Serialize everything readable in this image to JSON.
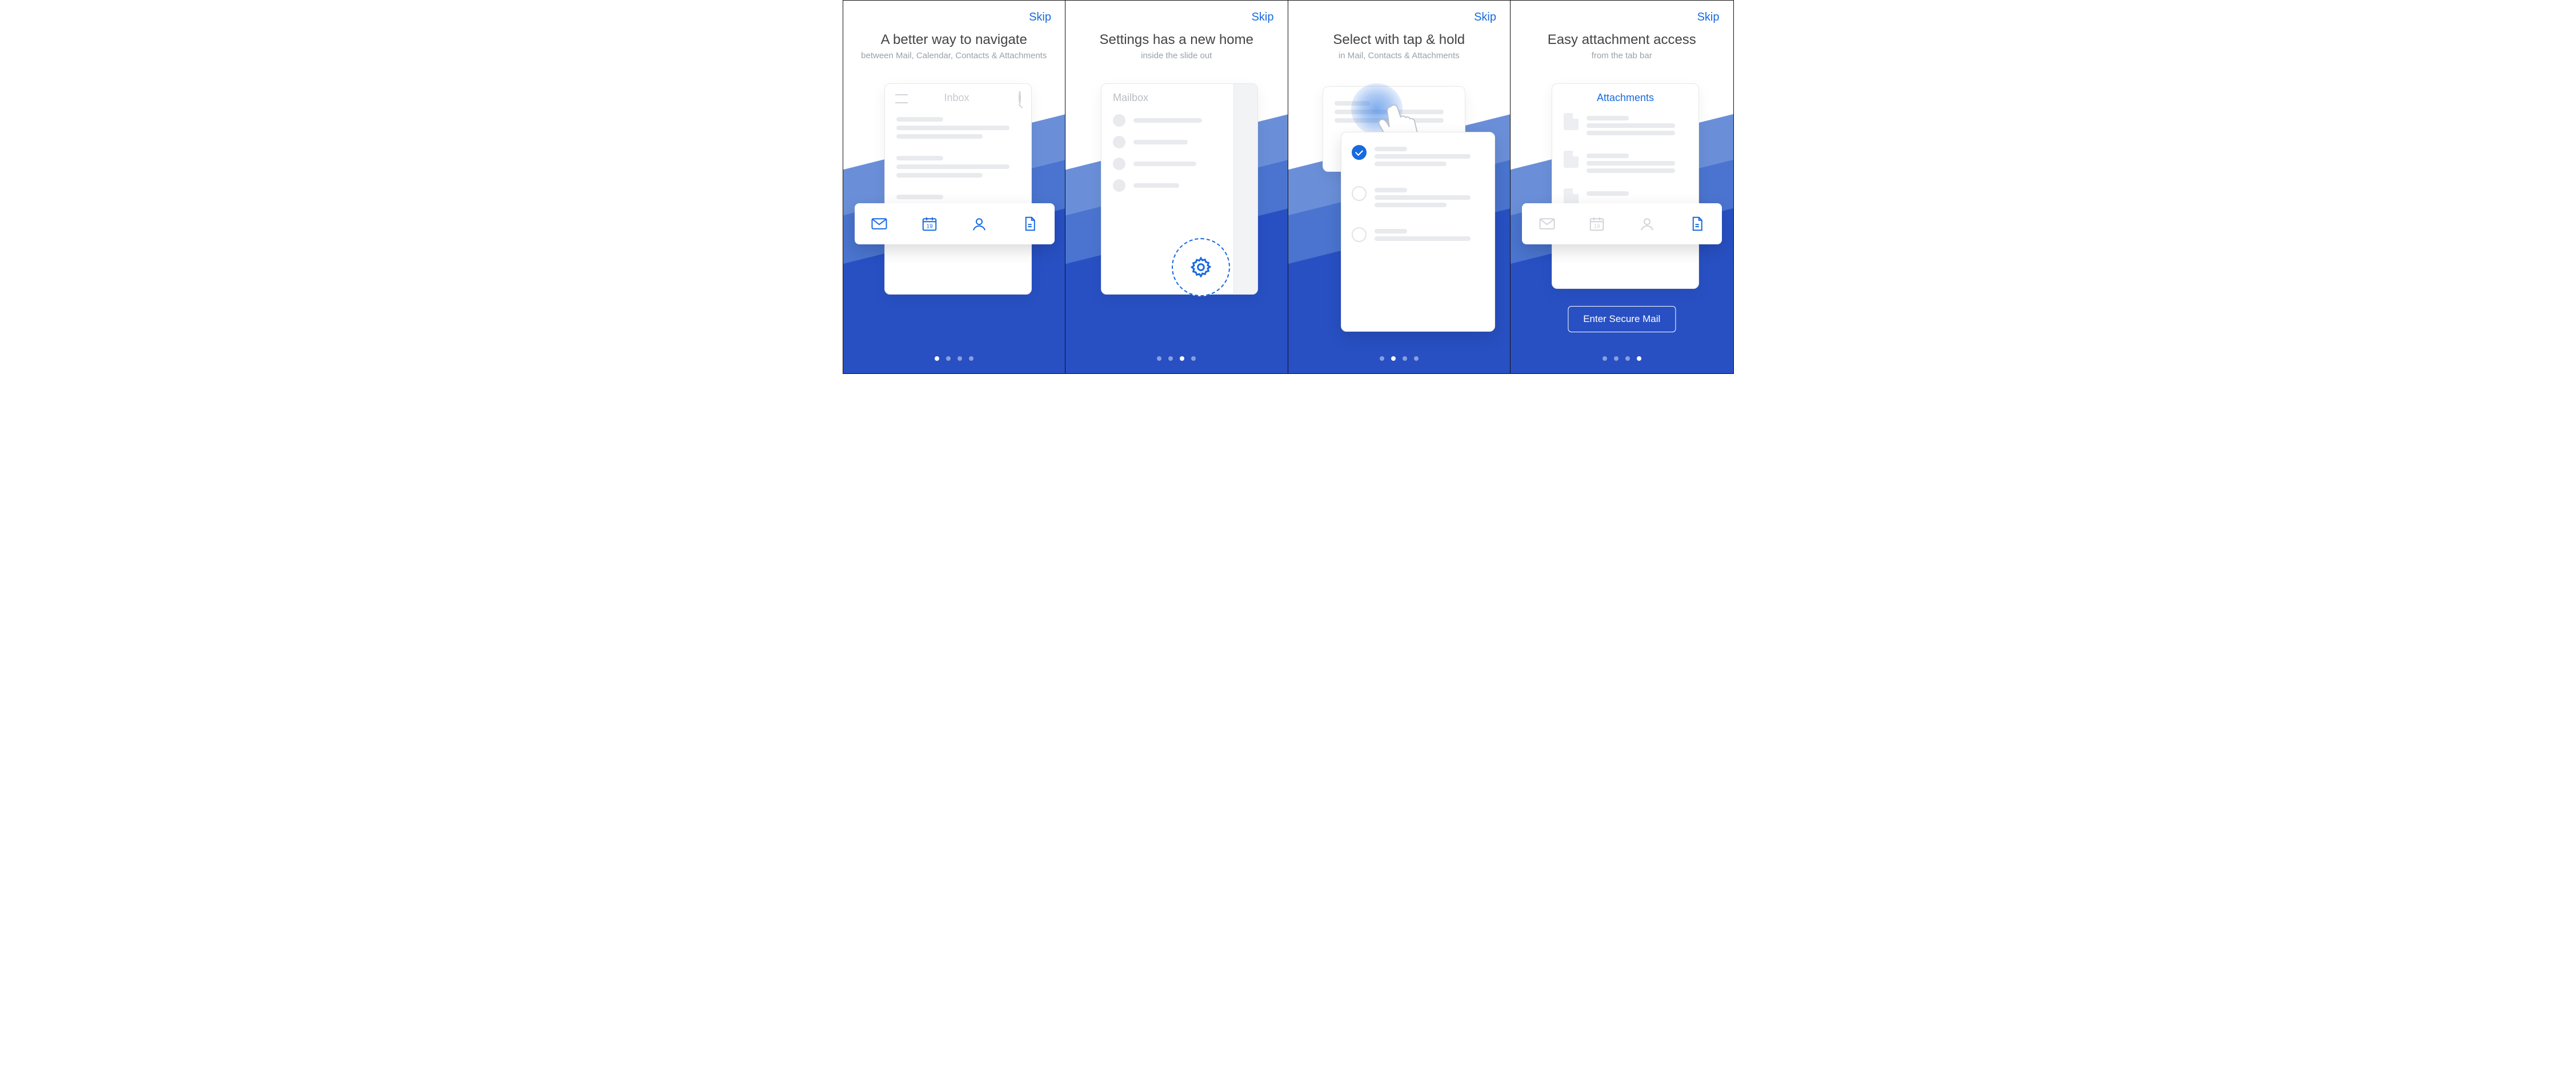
{
  "skip_label": "Skip",
  "screens": [
    {
      "title": "A better way to navigate",
      "subtitle": "between Mail, Calendar, Contacts & Attachments",
      "card_title": "Inbox",
      "tabs": [
        "mail",
        "calendar",
        "contacts",
        "attachments"
      ],
      "calendar_day": "19"
    },
    {
      "title": "Settings has a new home",
      "subtitle": "inside the slide out",
      "card_title": "Mailbox"
    },
    {
      "title": "Select with tap & hold",
      "subtitle": "in Mail, Contacts & Attachments"
    },
    {
      "title": "Easy attachment access",
      "subtitle": "from the tab bar",
      "card_title": "Attachments",
      "enter_label": "Enter Secure Mail",
      "calendar_day": "19"
    }
  ]
}
